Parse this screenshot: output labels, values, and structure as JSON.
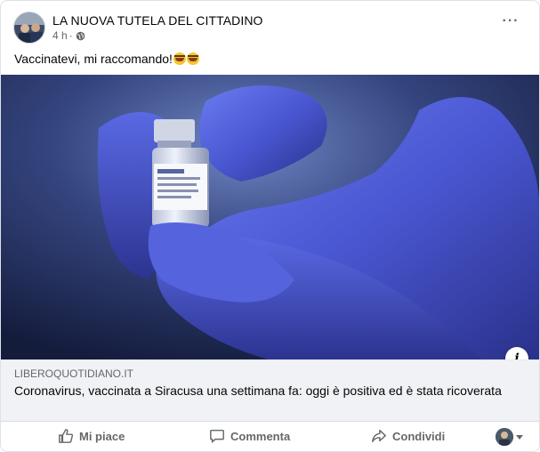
{
  "post": {
    "page_name": "LA NUOVA TUTELA DEL CITTADINO",
    "time": "4 h",
    "separator": "·",
    "privacy_icon": "globe-icon",
    "more_icon": "more-horizontal-icon",
    "more_label": "···",
    "text": "Vaccinatevi, mi raccomando!",
    "emojis": [
      "rolling-on-floor-laughing-emoji",
      "rolling-on-floor-laughing-emoji"
    ]
  },
  "link": {
    "domain": "LIBEROQUOTIDIANO.IT",
    "title": "Coronavirus, vaccinata a Siracusa una settimana fa: oggi è positiva ed è stata ricoverata",
    "info_label": "i",
    "image_icon": "vaccine-vial-photo"
  },
  "actions": {
    "like": "Mi piace",
    "comment": "Commenta",
    "share": "Condividi"
  },
  "colors": {
    "text_primary": "#050505",
    "text_secondary": "#65676b",
    "link_bg": "#f0f2f5",
    "glove_blue": "#4a5bd8"
  }
}
